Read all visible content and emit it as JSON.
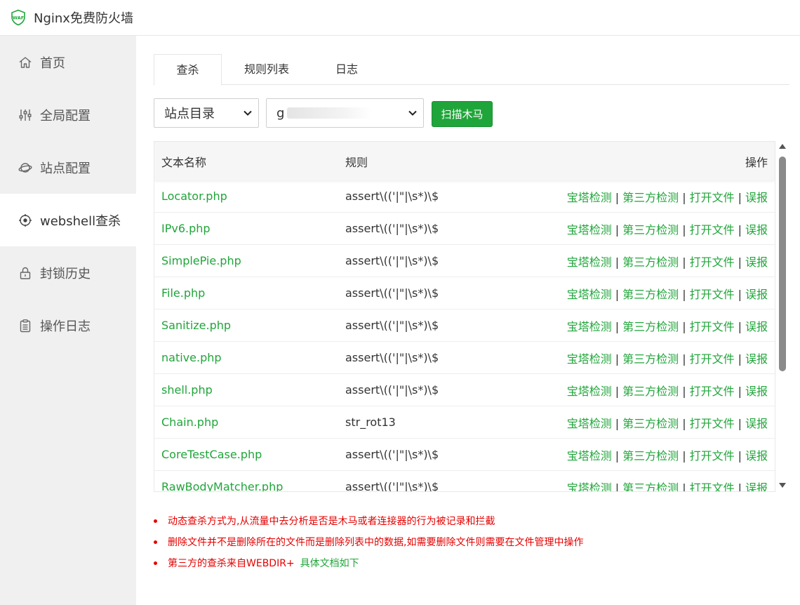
{
  "app": {
    "title": "Nginx免费防火墙",
    "logo_text": "WAF"
  },
  "colors": {
    "accent": "#20a53a",
    "warning": "#e50000"
  },
  "sidebar": {
    "items": [
      {
        "label": "首页",
        "icon": "home-icon"
      },
      {
        "label": "全局配置",
        "icon": "sliders-icon"
      },
      {
        "label": "站点配置",
        "icon": "planet-icon"
      },
      {
        "label": "webshell查杀",
        "icon": "target-icon",
        "active": true
      },
      {
        "label": "封锁历史",
        "icon": "lock-icon"
      },
      {
        "label": "操作日志",
        "icon": "clipboard-icon"
      }
    ]
  },
  "tabs": [
    {
      "label": "查杀",
      "active": true
    },
    {
      "label": "规则列表"
    },
    {
      "label": "日志"
    }
  ],
  "toolbar": {
    "dir_select": "站点目录",
    "site_select_prefix": "g",
    "scan_button": "扫描木马"
  },
  "table": {
    "headers": {
      "name": "文本名称",
      "rule": "规则",
      "ops": "操作"
    },
    "ops": [
      "宝塔检测",
      "第三方检测",
      "打开文件",
      "误报"
    ],
    "rows": [
      {
        "name": "Locator.php",
        "rule": "assert\\(('|\"|\\s*)\\$"
      },
      {
        "name": "IPv6.php",
        "rule": "assert\\(('|\"|\\s*)\\$"
      },
      {
        "name": "SimplePie.php",
        "rule": "assert\\(('|\"|\\s*)\\$"
      },
      {
        "name": "File.php",
        "rule": "assert\\(('|\"|\\s*)\\$"
      },
      {
        "name": "Sanitize.php",
        "rule": "assert\\(('|\"|\\s*)\\$"
      },
      {
        "name": "native.php",
        "rule": "assert\\(('|\"|\\s*)\\$"
      },
      {
        "name": "shell.php",
        "rule": "assert\\(('|\"|\\s*)\\$"
      },
      {
        "name": "Chain.php",
        "rule": "str_rot13"
      },
      {
        "name": "CoreTestCase.php",
        "rule": "assert\\(('|\"|\\s*)\\$"
      },
      {
        "name": "RawBodyMatcher.php",
        "rule": "assert\\(('|\"|\\s*)\\$"
      }
    ]
  },
  "notes": [
    "动态查杀方式为,从流量中去分析是否是木马或者连接器的行为被记录和拦截",
    "删除文件并不是删除所在的文件而是删除列表中的数据,如需要删除文件则需要在文件管理中操作",
    "第三方的查杀来自WEBDIR+"
  ],
  "notes_link": "具体文档如下"
}
